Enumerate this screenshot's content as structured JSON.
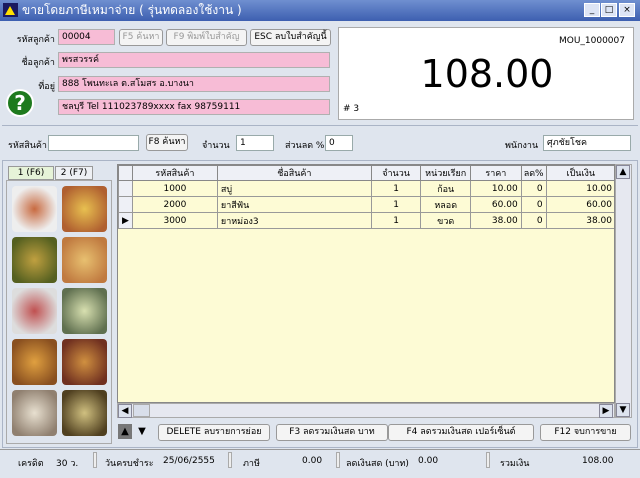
{
  "title": "ขายโดยภาษีเหมาจ่าย ( รุ่นทดลองใช้งาน )",
  "window": {
    "minimize": "_",
    "maximize": "□",
    "close": "×"
  },
  "customer": {
    "code_label": "รหัสลูกค้า",
    "code": "00004",
    "search_btn": "F5 ค้นหา",
    "print_btn": "F9 พิมพ์ใบสำคัญ",
    "delete_btn": "ESC ลบใบสำคัญนี้",
    "name_label": "ชื่อลูกค้า",
    "name": "พรสวรรค์",
    "address_label": "ที่อยู่",
    "address1": "888 โพนทะเล ต.สโมสร  อ.บางนา",
    "address2": "ชลบุรี Tel 111023789xxxx fax 98759111"
  },
  "display": {
    "doc_no": "MOU_1000007",
    "total": "108.00",
    "count": "# 3"
  },
  "entry": {
    "product_label": "รหัสสินค้า",
    "product_value": "",
    "search_btn": "F8 ค้นหา",
    "qty_label": "จำนวน",
    "qty": "1",
    "discount_label": "ส่วนลด %",
    "discount": "0",
    "staff_label": "พนักงาน",
    "staff": "ศุภชัยโชค"
  },
  "tabs": [
    "1 (F6)",
    "2 (F7)"
  ],
  "table": {
    "headers": [
      "รหัสสินค้า",
      "ชื่อสินค้า",
      "จำนวน",
      "หน่วยเรียก",
      "ราคา",
      "ลด%",
      "เป็นเงิน"
    ],
    "rows": [
      [
        "1000",
        "สบู่",
        "1",
        "ก้อน",
        "10.00",
        "0",
        "10.00"
      ],
      [
        "2000",
        "ยาสีฟัน",
        "1",
        "หลอด",
        "60.00",
        "0",
        "60.00"
      ],
      [
        "3000",
        "ยาหม่อง3",
        "1",
        "ขวด",
        "38.00",
        "0",
        "38.00"
      ]
    ]
  },
  "actions": {
    "delete": "DELETE ลบรายการย่อย",
    "f3": "F3 ลดรวมเงินสด บาท",
    "f4": "F4 ลดรวมเงินสด เปอร์เซ็นต์",
    "f12": "F12 จบการขาย"
  },
  "status": {
    "credit_label": "เครดิต",
    "credit": "30 ว.",
    "due_label": "วันครบชำระ",
    "due": "25/06/2555",
    "tax_label": "ภาษี",
    "tax": "0.00",
    "cash_disc_label": "ลดเงินสด (บาท)",
    "cash_disc": "0.00",
    "sum_label": "รวมเงิน",
    "sum": "108.00"
  }
}
